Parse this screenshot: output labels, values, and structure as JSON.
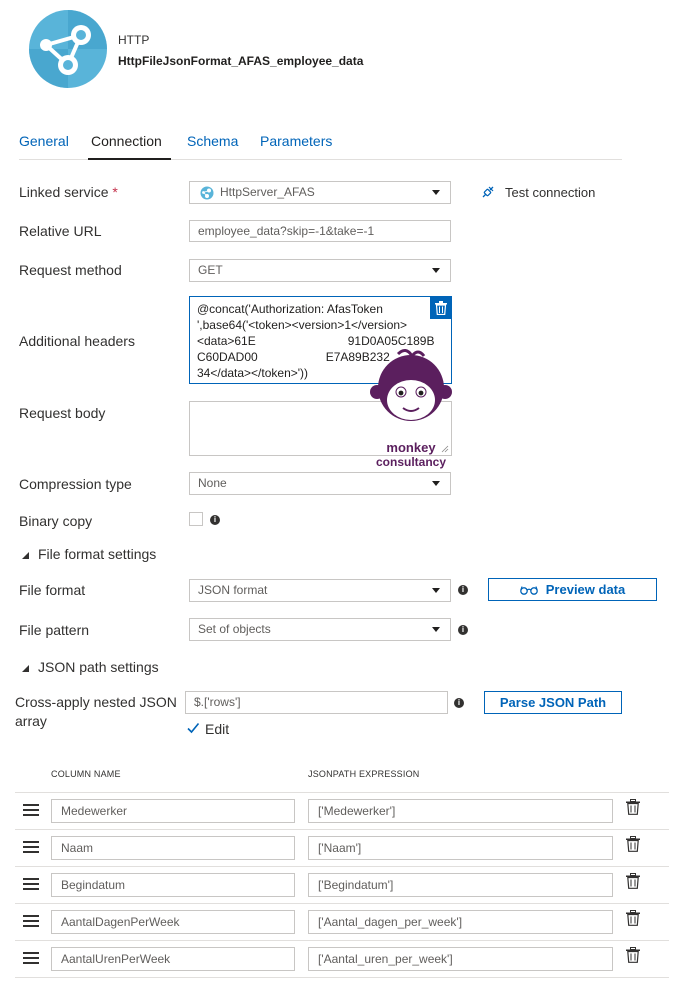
{
  "dataset": {
    "type": "HTTP",
    "name": "HttpFileJsonFormat_AFAS_employee_data",
    "icon": "http-dataset-icon"
  },
  "tabs": [
    {
      "label": "General",
      "active": false
    },
    {
      "label": "Connection",
      "active": true
    },
    {
      "label": "Schema",
      "active": false
    },
    {
      "label": "Parameters",
      "active": false
    }
  ],
  "form": {
    "linked_service": {
      "label": "Linked service",
      "required_mark": "*",
      "value": "HttpServer_AFAS"
    },
    "test_connection": "Test connection",
    "relative_url": {
      "label": "Relative URL",
      "value": "employee_data?skip=-1&take=-1"
    },
    "request_method": {
      "label": "Request method",
      "value": "GET"
    },
    "additional_headers": {
      "label": "Additional headers",
      "line1": "@concat('Authorization: AfasToken",
      "line2": "',base64('<token><version>1</version>",
      "line3a": "<data>61E",
      "line3b": "91D0A05C189B",
      "line4a": "C60DAD00",
      "line4b": "E7A89B232",
      "line5": "34</data></token>'))"
    },
    "request_body": {
      "label": "Request body",
      "value": ""
    },
    "compression_type": {
      "label": "Compression type",
      "value": "None"
    },
    "binary_copy": {
      "label": "Binary copy",
      "checked": false
    }
  },
  "file_format_settings": {
    "title": "File format settings",
    "file_format": {
      "label": "File format",
      "value": "JSON format"
    },
    "preview_data": "Preview data",
    "file_pattern": {
      "label": "File pattern",
      "value": "Set of objects"
    }
  },
  "json_path_settings": {
    "title": "JSON path settings",
    "cross_apply": {
      "label_line1": "Cross-apply nested JSON",
      "label_line2": "array",
      "value": "$.['rows']"
    },
    "parse_button": "Parse JSON Path",
    "edit": {
      "label": "Edit",
      "checked": true
    }
  },
  "mapping_table": {
    "columns": [
      "COLUMN NAME",
      "JSONPATH EXPRESSION"
    ],
    "rows": [
      {
        "column": "Medewerker",
        "path": "['Medewerker']"
      },
      {
        "column": "Naam",
        "path": "['Naam']"
      },
      {
        "column": "Begindatum",
        "path": "['Begindatum']"
      },
      {
        "column": "AantalDagenPerWeek",
        "path": "['Aantal_dagen_per_week']"
      },
      {
        "column": "AantalUrenPerWeek",
        "path": "['Aantal_uren_per_week']"
      }
    ]
  },
  "watermark": {
    "line1": "monkey",
    "line2": "consultancy"
  },
  "colors": {
    "accent": "#0064b8",
    "brand_purple": "#5b1f5e",
    "logo_blue": "#59b4d9"
  }
}
